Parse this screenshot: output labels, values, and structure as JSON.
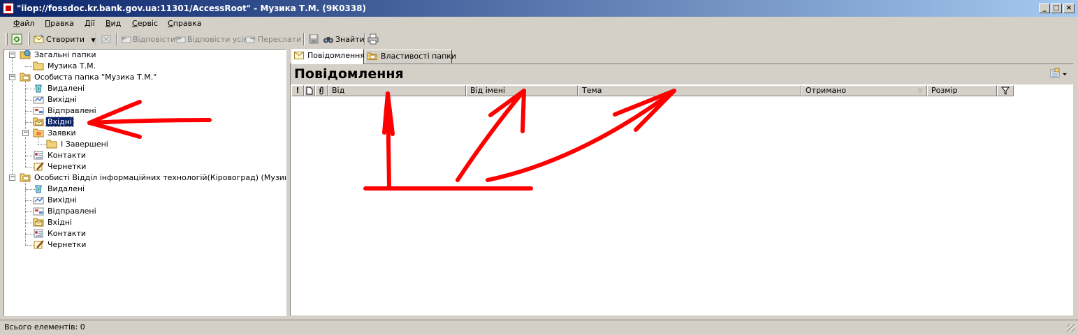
{
  "window": {
    "title": "\"iiop://fossdoc.kr.bank.gov.ua:11301/AccessRoot\" - Музика Т.М. (9К0338)",
    "controls": {
      "minimize": "_",
      "maximize": "□",
      "close": "×"
    }
  },
  "menu": {
    "items": [
      "Файл",
      "Правка",
      "Дії",
      "Вид",
      "Сервіс",
      "Справка"
    ]
  },
  "toolbar": {
    "create": "Створити",
    "reply": "Відповісти",
    "reply_all": "Відповісти усім",
    "forward": "Переслати",
    "find": "Знайти"
  },
  "tree": {
    "items": [
      {
        "label": "Загальні папки"
      },
      {
        "label": "Музика Т.М."
      },
      {
        "label": "Особиста папка \"Музика Т.М.\""
      },
      {
        "label": "Видалені"
      },
      {
        "label": "Вихідні"
      },
      {
        "label": "Відправлені"
      },
      {
        "label": "Вхідні"
      },
      {
        "label": "Заявки"
      },
      {
        "label": "І Завершені"
      },
      {
        "label": "Контакти"
      },
      {
        "label": "Чернетки"
      },
      {
        "label": "Особисті Відділ інформаційних технологій(Кіровоград) (Музика Т.М.)"
      },
      {
        "label": "Видалені"
      },
      {
        "label": "Вихідні"
      },
      {
        "label": "Відправлені"
      },
      {
        "label": "Вхідні"
      },
      {
        "label": "Контакти"
      },
      {
        "label": "Чернетки"
      }
    ]
  },
  "tabs": [
    "Повідомлення",
    "Властивості папки"
  ],
  "content": {
    "title": "Повідомлення",
    "columns": [
      "!",
      "",
      "",
      "Від",
      "Від імені",
      "Тема",
      "Отримано",
      "Розмір",
      ""
    ]
  },
  "status": {
    "text": "Всього елементів: 0"
  },
  "colors": {
    "title_gradient_start": "#0a246a",
    "title_gradient_end": "#a6caf0",
    "selection": "#0a246a",
    "annotation": "#ff0000",
    "window_bg": "#d4d0c8"
  }
}
